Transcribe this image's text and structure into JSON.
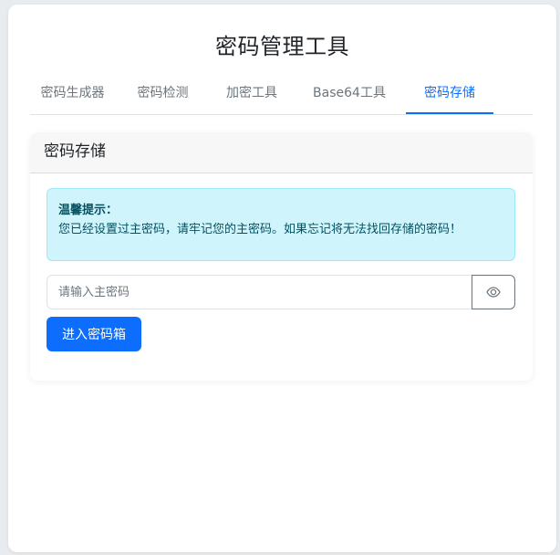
{
  "app": {
    "title": "密码管理工具"
  },
  "tabs": [
    {
      "label": "密码生成器",
      "active": false
    },
    {
      "label": "密码检测",
      "active": false
    },
    {
      "label": "加密工具",
      "active": false
    },
    {
      "label": "Base64工具",
      "active": false
    },
    {
      "label": "密码存储",
      "active": true
    }
  ],
  "panel": {
    "title": "密码存储",
    "alert": {
      "title": "温馨提示：",
      "message": "您已经设置过主密码，请牢记您的主密码。如果忘记将无法找回存储的密码！"
    },
    "master_password": {
      "value": "",
      "placeholder": "请输入主密码",
      "toggle_icon": "eye-icon"
    },
    "enter_button_label": "进入密码箱"
  },
  "colors": {
    "accent": "#0d6efd",
    "alert_bg": "#cff4fc",
    "alert_border": "#9eeaf9",
    "alert_text": "#055160",
    "tab_inactive": "#6c757d"
  }
}
